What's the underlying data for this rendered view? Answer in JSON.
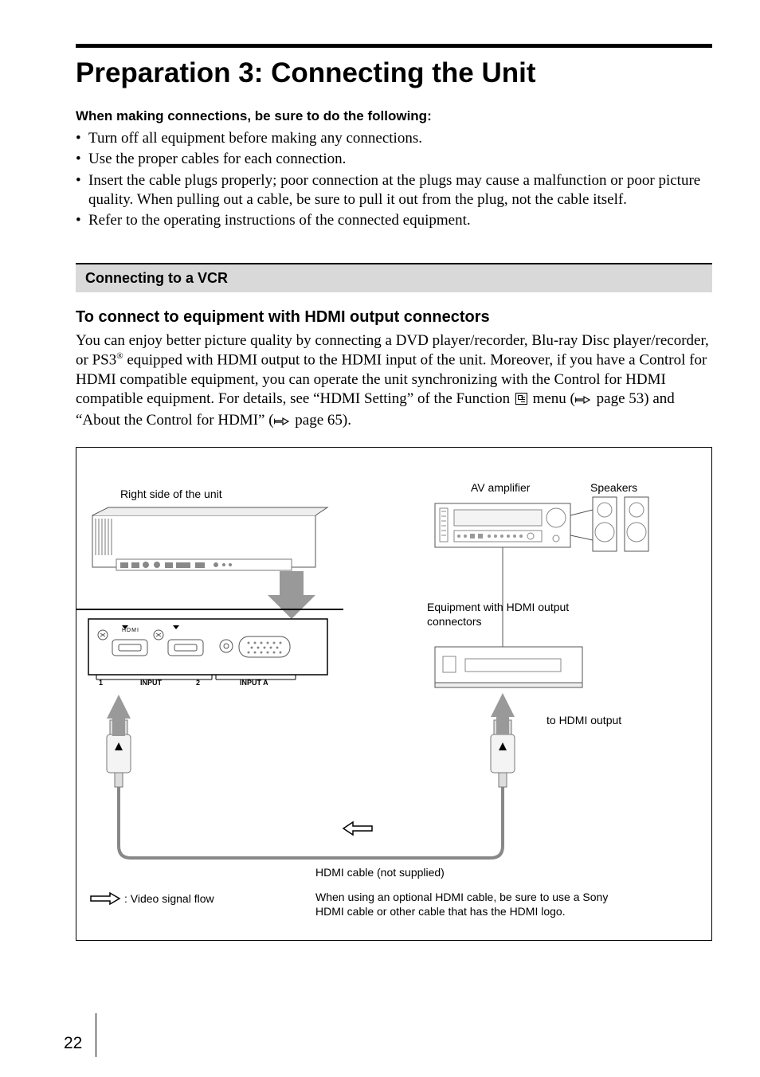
{
  "title": "Preparation 3: Connecting the Unit",
  "subhead": "When making connections, be sure to do the following:",
  "bullets": [
    "Turn off all equipment before making any connections.",
    "Use the proper cables for each connection.",
    "Insert the cable plugs properly; poor connection at the plugs may cause a malfunction or poor picture quality. When pulling out a cable, be sure to pull it out from the plug, not the cable itself.",
    "Refer to the operating instructions of the connected equipment."
  ],
  "section_bar": "Connecting to a VCR",
  "subsection": "To connect to equipment with HDMI output connectors",
  "body_before": "You can enjoy better picture quality by connecting a DVD player/recorder, Blu-ray Disc player/recorder, or PS3",
  "body_sup": "®",
  "body_mid": " equipped with HDMI output to the HDMI input of the unit. Moreover, if you have a Control for HDMI compatible equipment, you can operate the unit synchronizing with the Control for HDMI compatible equipment. For details, see “HDMI Setting” of the Function ",
  "body_after_icon": " menu (",
  "page_ref1": " page 53) and “About the Control for HDMI” (",
  "page_ref2": " page 65).",
  "diagram": {
    "right_side": "Right side of the unit",
    "av_amp": "AV amplifier",
    "speakers": "Speakers",
    "equipment": "Equipment with HDMI output connectors",
    "to_hdmi": "to HDMI output",
    "cable": "HDMI cable (not supplied)",
    "flow": ": Video signal flow",
    "note": "When using an optional HDMI cable, be sure to use a Sony HDMI cable or other cable that has the HDMI logo.",
    "input_label": "INPUT",
    "input_a": "INPUT A",
    "hdmi_logo": "HDMI",
    "one": "1",
    "two": "2"
  },
  "page_number": "22"
}
